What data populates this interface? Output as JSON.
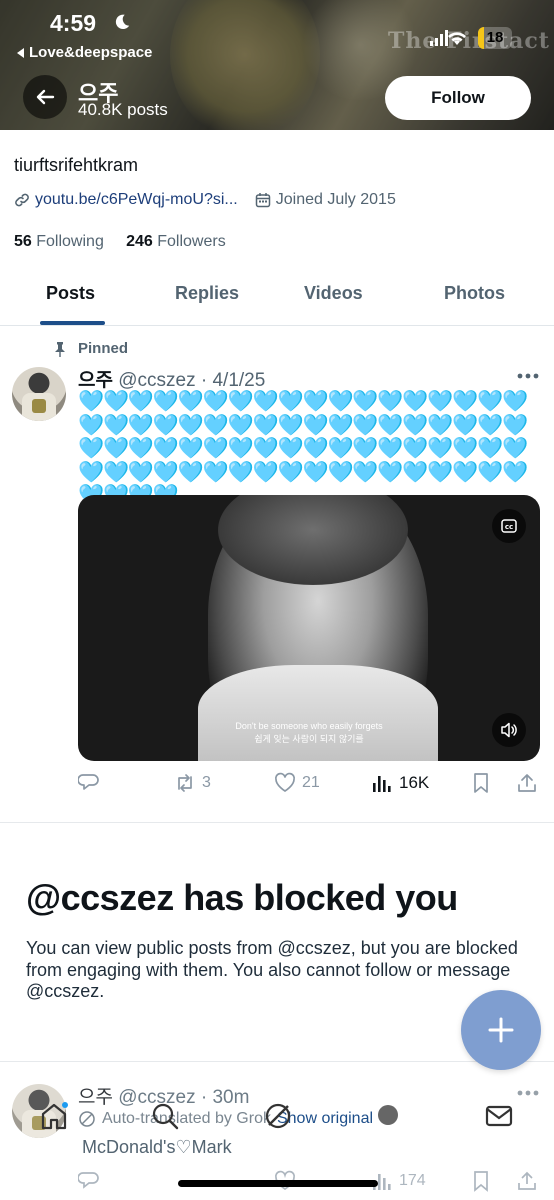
{
  "status_bar": {
    "time": "4:59",
    "back_app": "Love&deepspace",
    "battery": "18",
    "battery_level": 0.18,
    "watermark": "The Firstact"
  },
  "header": {
    "name": "으주",
    "post_count": "40.8K posts",
    "follow_label": "Follow"
  },
  "profile": {
    "bio": "tiurftsrifehtkram",
    "link": "youtu.be/c6PeWqj-moU?si...",
    "joined": "Joined July 2015",
    "following_count": "56",
    "following_label": "Following",
    "followers_count": "246",
    "followers_label": "Followers"
  },
  "tabs": [
    {
      "label": "Posts",
      "active": true
    },
    {
      "label": "Replies",
      "active": false
    },
    {
      "label": "Videos",
      "active": false
    },
    {
      "label": "Photos",
      "active": false
    }
  ],
  "pinned_post": {
    "pinned_label": "Pinned",
    "display_name": "으주",
    "handle_date": "@ccszez · 4/1/25",
    "hearts": "🩵🩵🩵🩵🩵🩵🩵🩵🩵🩵🩵🩵🩵🩵🩵🩵🩵🩵🩵🩵🩵🩵🩵🩵🩵🩵🩵🩵🩵🩵🩵🩵🩵🩵🩵🩵🩵🩵🩵🩵🩵🩵🩵🩵🩵🩵🩵🩵🩵🩵🩵🩵🩵🩵🩵🩵🩵🩵🩵🩵🩵🩵🩵🩵🩵🩵🩵🩵🩵🩵🩵🩵🩵🩵🩵🩵",
    "subtitle_en": "Don't be someone who easily forgets",
    "subtitle_ko": "쉽게 잊는 사람이 되지 않기를",
    "reposts": "3",
    "likes": "21",
    "views": "16K"
  },
  "blocked": {
    "title": "@ccszez has blocked you",
    "body": "You can view public posts from @ccszez, but you are blocked from engaging with them. You also cannot follow or message @ccszez."
  },
  "second_post": {
    "display_name": "으주",
    "handle_time": "@ccszez · 30m",
    "auto_translated": "Auto-translated by Grok",
    "show_original": "Show original",
    "text": "McDonald's♡Mark",
    "views": "174"
  },
  "colors": {
    "accent": "#1d4e89",
    "fab": "#7f9ed0",
    "heart": "#5ec8ee",
    "battery": "#f5c518"
  },
  "icons": [
    "moon-icon",
    "signal-icon",
    "wifi-icon",
    "back-arrow-icon",
    "link-icon",
    "calendar-icon",
    "pin-icon",
    "more-icon",
    "cc-icon",
    "volume-icon",
    "reply-icon",
    "repost-icon",
    "like-icon",
    "views-icon",
    "bookmark-icon",
    "share-icon",
    "plus-icon",
    "home-icon",
    "search-icon",
    "grok-icon",
    "communities-icon",
    "messages-icon"
  ]
}
